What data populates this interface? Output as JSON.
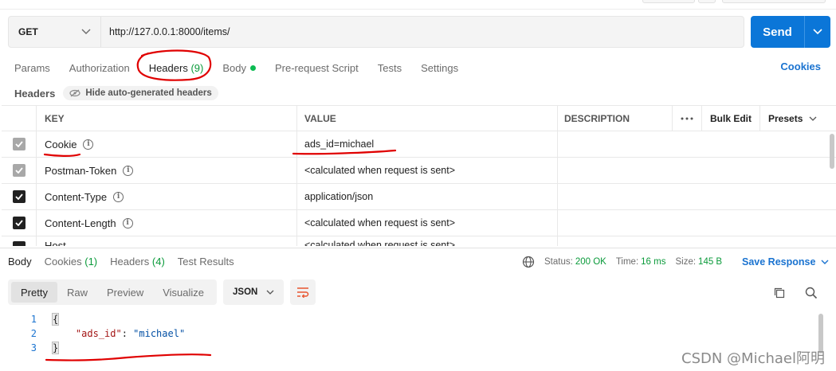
{
  "request": {
    "method": "GET",
    "url": "http://127.0.0.1:8000/items/",
    "send_label": "Send"
  },
  "tabs": [
    {
      "label": "Params",
      "count": ""
    },
    {
      "label": "Authorization",
      "count": ""
    },
    {
      "label": "Headers",
      "count": "(9)"
    },
    {
      "label": "Body",
      "count": ""
    },
    {
      "label": "Pre-request Script",
      "count": ""
    },
    {
      "label": "Tests",
      "count": ""
    },
    {
      "label": "Settings",
      "count": ""
    }
  ],
  "cookies_link": "Cookies",
  "headers_section": {
    "title": "Headers",
    "hide_auto": "Hide auto-generated headers"
  },
  "table": {
    "columns": {
      "key": "KEY",
      "value": "VALUE",
      "description": "DESCRIPTION",
      "bulk_edit": "Bulk Edit",
      "presets": "Presets"
    },
    "rows": [
      {
        "key": "Cookie",
        "value": "ads_id=michael",
        "checked": "grey"
      },
      {
        "key": "Postman-Token",
        "value": "<calculated when request is sent>",
        "checked": "grey"
      },
      {
        "key": "Content-Type",
        "value": "application/json",
        "checked": "black"
      },
      {
        "key": "Content-Length",
        "value": "<calculated when request is sent>",
        "checked": "black"
      },
      {
        "key": "Host",
        "value": "<calculated when request is sent>",
        "checked": "black"
      }
    ]
  },
  "response": {
    "tabs": [
      {
        "label": "Body",
        "count": ""
      },
      {
        "label": "Cookies",
        "count": "(1)"
      },
      {
        "label": "Headers",
        "count": "(4)"
      },
      {
        "label": "Test Results",
        "count": ""
      }
    ],
    "status_label": "Status:",
    "status_value": "200 OK",
    "time_label": "Time:",
    "time_value": "16 ms",
    "size_label": "Size:",
    "size_value": "145 B",
    "save_label": "Save Response",
    "views": [
      "Pretty",
      "Raw",
      "Preview",
      "Visualize"
    ],
    "format": "JSON",
    "code": {
      "line_numbers": [
        "1",
        "2",
        "3"
      ],
      "open_brace": "{",
      "key": "\"ads_id\"",
      "colon": ": ",
      "value": "\"michael\"",
      "close_brace": "}"
    }
  },
  "watermark": "CSDN @Michael阿明",
  "colors": {
    "accent": "#0b76d8",
    "link": "#1a73d0",
    "success": "#0a9a3a",
    "annotation": "#e00000"
  }
}
